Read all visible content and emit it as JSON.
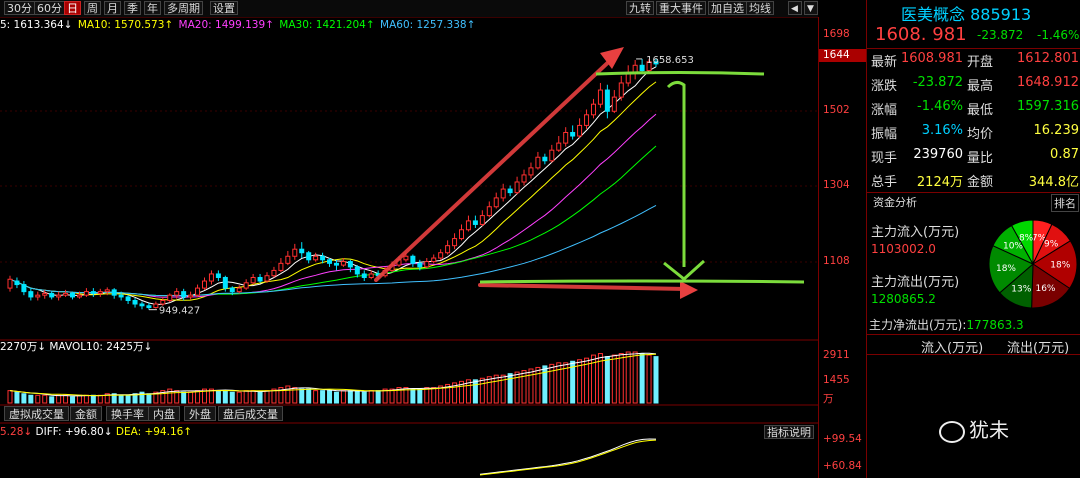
{
  "toolbar": {
    "periods": [
      "30分",
      "60分",
      "日",
      "周",
      "月",
      "季",
      "年",
      "多周期",
      "设置"
    ],
    "active_period": "日",
    "right_buttons": [
      "九转",
      "重大事件",
      "加自选",
      "均线"
    ],
    "left_arrow": "◀",
    "right_arrow": "▼"
  },
  "ma_legend": {
    "ma5": "5: 1613.364↓",
    "ma10": "MA10: 1570.573↑",
    "ma20": "MA20: 1499.139↑",
    "ma30": "MA30: 1421.204↑",
    "ma60": "MA60: 1257.338↑",
    "colors": {
      "ma5": "#ffffff",
      "ma10": "#ffff00",
      "ma20": "#ff00ff",
      "ma30": "#00ff00",
      "ma60": "#00aaff"
    }
  },
  "price_axis": {
    "labels": [
      "1698",
      "1502",
      "1304",
      "1108"
    ],
    "current": "1644"
  },
  "volume_axis": {
    "labels": [
      "2911",
      "1455"
    ],
    "unit": "万"
  },
  "macd_axis": {
    "labels": [
      "+99.54",
      "+60.84"
    ]
  },
  "annotations": {
    "high_label": "1658.653",
    "low_label": "949.427"
  },
  "volume_legend": {
    "vol": "2270万↓",
    "mavol10": "MAVOL10: 2425万↓"
  },
  "volume_tabs": [
    "虚拟成交量",
    "金额",
    "换手率",
    "内盘",
    "外盘",
    "盘后成交量"
  ],
  "macd_legend": {
    "dea_left": "5.28↓",
    "diff": "DIFF: +96.80↓",
    "dea": "DEA: +94.16↑"
  },
  "indicator_button": "指标说明",
  "chart_data": {
    "type": "candlestick",
    "title": "医美概念 885913",
    "price_ylim": [
      900,
      1720
    ],
    "candles": [
      [
        1010,
        1035,
        1000,
        1045
      ],
      [
        1030,
        1020,
        1010,
        1040
      ],
      [
        1020,
        1000,
        990,
        1030
      ],
      [
        1000,
        985,
        975,
        1010
      ],
      [
        985,
        990,
        975,
        1000
      ],
      [
        990,
        995,
        980,
        1005
      ],
      [
        995,
        985,
        978,
        1000
      ],
      [
        985,
        990,
        975,
        1000
      ],
      [
        990,
        995,
        985,
        1005
      ],
      [
        995,
        985,
        978,
        1000
      ],
      [
        985,
        990,
        980,
        1000
      ],
      [
        990,
        1000,
        985,
        1010
      ],
      [
        1000,
        995,
        985,
        1010
      ],
      [
        995,
        1000,
        985,
        1008
      ],
      [
        1000,
        1005,
        990,
        1012
      ],
      [
        1005,
        990,
        980,
        1010
      ],
      [
        990,
        985,
        975,
        1000
      ],
      [
        985,
        975,
        965,
        990
      ],
      [
        975,
        965,
        955,
        982
      ],
      [
        965,
        960,
        950,
        972
      ],
      [
        960,
        955,
        949,
        968
      ],
      [
        955,
        965,
        952,
        972
      ],
      [
        965,
        975,
        960,
        985
      ],
      [
        975,
        990,
        970,
        995
      ],
      [
        990,
        1000,
        980,
        1010
      ],
      [
        1000,
        985,
        975,
        1008
      ],
      [
        985,
        990,
        978,
        1000
      ],
      [
        990,
        1010,
        985,
        1020
      ],
      [
        1010,
        1030,
        1005,
        1040
      ],
      [
        1030,
        1050,
        1020,
        1060
      ],
      [
        1050,
        1040,
        1030,
        1060
      ],
      [
        1040,
        1010,
        1000,
        1045
      ],
      [
        1010,
        1000,
        990,
        1015
      ],
      [
        1000,
        1010,
        995,
        1018
      ],
      [
        1010,
        1025,
        1005,
        1035
      ],
      [
        1025,
        1040,
        1020,
        1050
      ],
      [
        1040,
        1030,
        1025,
        1050
      ],
      [
        1030,
        1045,
        1025,
        1055
      ],
      [
        1045,
        1060,
        1040,
        1070
      ],
      [
        1060,
        1080,
        1055,
        1095
      ],
      [
        1080,
        1100,
        1075,
        1115
      ],
      [
        1100,
        1120,
        1090,
        1135
      ],
      [
        1120,
        1110,
        1095,
        1140
      ],
      [
        1110,
        1090,
        1080,
        1115
      ],
      [
        1090,
        1100,
        1085,
        1110
      ],
      [
        1100,
        1090,
        1080,
        1110
      ],
      [
        1090,
        1080,
        1070,
        1095
      ],
      [
        1080,
        1075,
        1060,
        1090
      ],
      [
        1075,
        1085,
        1070,
        1095
      ],
      [
        1085,
        1070,
        1055,
        1090
      ],
      [
        1070,
        1050,
        1040,
        1075
      ],
      [
        1050,
        1040,
        1030,
        1060
      ],
      [
        1040,
        1050,
        1035,
        1060
      ],
      [
        1050,
        1045,
        1035,
        1060
      ],
      [
        1045,
        1060,
        1040,
        1070
      ],
      [
        1060,
        1075,
        1055,
        1085
      ],
      [
        1075,
        1090,
        1070,
        1100
      ],
      [
        1090,
        1100,
        1085,
        1110
      ],
      [
        1100,
        1080,
        1070,
        1105
      ],
      [
        1080,
        1070,
        1060,
        1090
      ],
      [
        1070,
        1085,
        1065,
        1095
      ],
      [
        1085,
        1095,
        1080,
        1105
      ],
      [
        1095,
        1110,
        1090,
        1120
      ],
      [
        1110,
        1130,
        1105,
        1145
      ],
      [
        1130,
        1150,
        1120,
        1165
      ],
      [
        1150,
        1175,
        1145,
        1190
      ],
      [
        1175,
        1200,
        1170,
        1215
      ],
      [
        1200,
        1190,
        1180,
        1215
      ],
      [
        1190,
        1215,
        1185,
        1230
      ],
      [
        1215,
        1240,
        1210,
        1255
      ],
      [
        1240,
        1265,
        1235,
        1280
      ],
      [
        1265,
        1290,
        1255,
        1305
      ],
      [
        1290,
        1280,
        1270,
        1300
      ],
      [
        1280,
        1310,
        1275,
        1325
      ],
      [
        1310,
        1330,
        1300,
        1345
      ],
      [
        1330,
        1350,
        1320,
        1365
      ],
      [
        1350,
        1380,
        1345,
        1395
      ],
      [
        1380,
        1370,
        1360,
        1390
      ],
      [
        1370,
        1400,
        1365,
        1415
      ],
      [
        1400,
        1420,
        1395,
        1440
      ],
      [
        1420,
        1450,
        1410,
        1465
      ],
      [
        1450,
        1440,
        1430,
        1470
      ],
      [
        1440,
        1470,
        1435,
        1490
      ],
      [
        1470,
        1500,
        1460,
        1515
      ],
      [
        1500,
        1530,
        1490,
        1545
      ],
      [
        1530,
        1570,
        1520,
        1590
      ],
      [
        1570,
        1510,
        1490,
        1585
      ],
      [
        1510,
        1550,
        1505,
        1570
      ],
      [
        1550,
        1590,
        1540,
        1610
      ],
      [
        1590,
        1620,
        1580,
        1640
      ],
      [
        1620,
        1640,
        1600,
        1655
      ],
      [
        1640,
        1625,
        1615,
        1658
      ],
      [
        1625,
        1650,
        1620,
        1658
      ],
      [
        1650,
        1644,
        1635,
        1658
      ]
    ],
    "volume": [
      8,
      7,
      6,
      5,
      5,
      5,
      4,
      5,
      5,
      4,
      5,
      5,
      5,
      5,
      6,
      6,
      5,
      5,
      6,
      7,
      6,
      7,
      8,
      9,
      8,
      7,
      7,
      8,
      9,
      9,
      8,
      8,
      7,
      7,
      8,
      8,
      7,
      8,
      9,
      10,
      11,
      10,
      9,
      9,
      8,
      8,
      8,
      7,
      8,
      8,
      8,
      7,
      8,
      8,
      9,
      9,
      10,
      10,
      9,
      9,
      10,
      10,
      11,
      12,
      13,
      14,
      15,
      15,
      16,
      17,
      18,
      18,
      19,
      20,
      21,
      22,
      23,
      24,
      25,
      26,
      26,
      27,
      28,
      29,
      31,
      32,
      30,
      31,
      32,
      33,
      33,
      32,
      31,
      30
    ],
    "macd_dif": [
      5,
      7,
      9,
      11,
      13,
      15,
      17,
      19,
      21,
      23,
      25,
      27,
      30,
      33,
      36,
      40,
      45,
      50,
      56,
      62,
      68,
      75,
      82,
      88,
      93,
      96,
      97,
      96.8
    ],
    "macd_dea": [
      3,
      5,
      7,
      9,
      11,
      13,
      15,
      17,
      19,
      21,
      23,
      25,
      27,
      30,
      33,
      37,
      42,
      47,
      53,
      59,
      65,
      71,
      77,
      83,
      88,
      91,
      93,
      94.16
    ]
  },
  "quote": {
    "name": "医美概念",
    "code": "885913",
    "price": "1608. 981",
    "change": "-23.872",
    "pct": "-1.46%",
    "rows": [
      {
        "l1": "最新",
        "v1": "1608.981",
        "l2": "开盘",
        "v2": "1612.801",
        "c1": "#ff4040",
        "c2": "#ff4040"
      },
      {
        "l1": "涨跌",
        "v1": "-23.872",
        "l2": "最高",
        "v2": "1648.912",
        "c1": "#00e000",
        "c2": "#ff4040"
      },
      {
        "l1": "涨幅",
        "v1": "-1.46%",
        "l2": "最低",
        "v2": "1597.316",
        "c1": "#00e000",
        "c2": "#00e000"
      },
      {
        "l1": "振幅",
        "v1": "3.16%",
        "l2": "均价",
        "v2": "16.239",
        "c1": "#00d0ff",
        "c2": "#ffff40"
      },
      {
        "l1": "现手",
        "v1": "239760",
        "l2": "量比",
        "v2": "0.87",
        "c1": "#ffffff",
        "c2": "#ffff40"
      },
      {
        "l1": "总手",
        "v1": "2124万",
        "l2": "金额",
        "v2": "344.8亿",
        "c1": "#ffff40",
        "c2": "#ffff40"
      }
    ]
  },
  "fund": {
    "title": "资金分析",
    "tab": "排名",
    "inflow_label": "主力流入(万元)",
    "inflow_value": "1103002.0",
    "outflow_label": "主力流出(万元)",
    "outflow_value": "1280865.2",
    "net_label": "主力净流出(万元):",
    "net_value": "177863.3",
    "col_in": "流入(万元)",
    "col_out": "流出(万元)",
    "pie": [
      {
        "label": "7%",
        "value": 7,
        "color": "#ff2020"
      },
      {
        "label": "9%",
        "value": 9,
        "color": "#e01010"
      },
      {
        "label": "18%",
        "value": 18,
        "color": "#b00000"
      },
      {
        "label": "16%",
        "value": 16,
        "color": "#7a0000"
      },
      {
        "label": "13%",
        "value": 13,
        "color": "#006000"
      },
      {
        "label": "18%",
        "value": 18,
        "color": "#008a00"
      },
      {
        "label": "10%",
        "value": 10,
        "color": "#00b000"
      },
      {
        "label": "8%",
        "value": 8,
        "color": "#00d800"
      }
    ]
  },
  "watermark": "犹未"
}
